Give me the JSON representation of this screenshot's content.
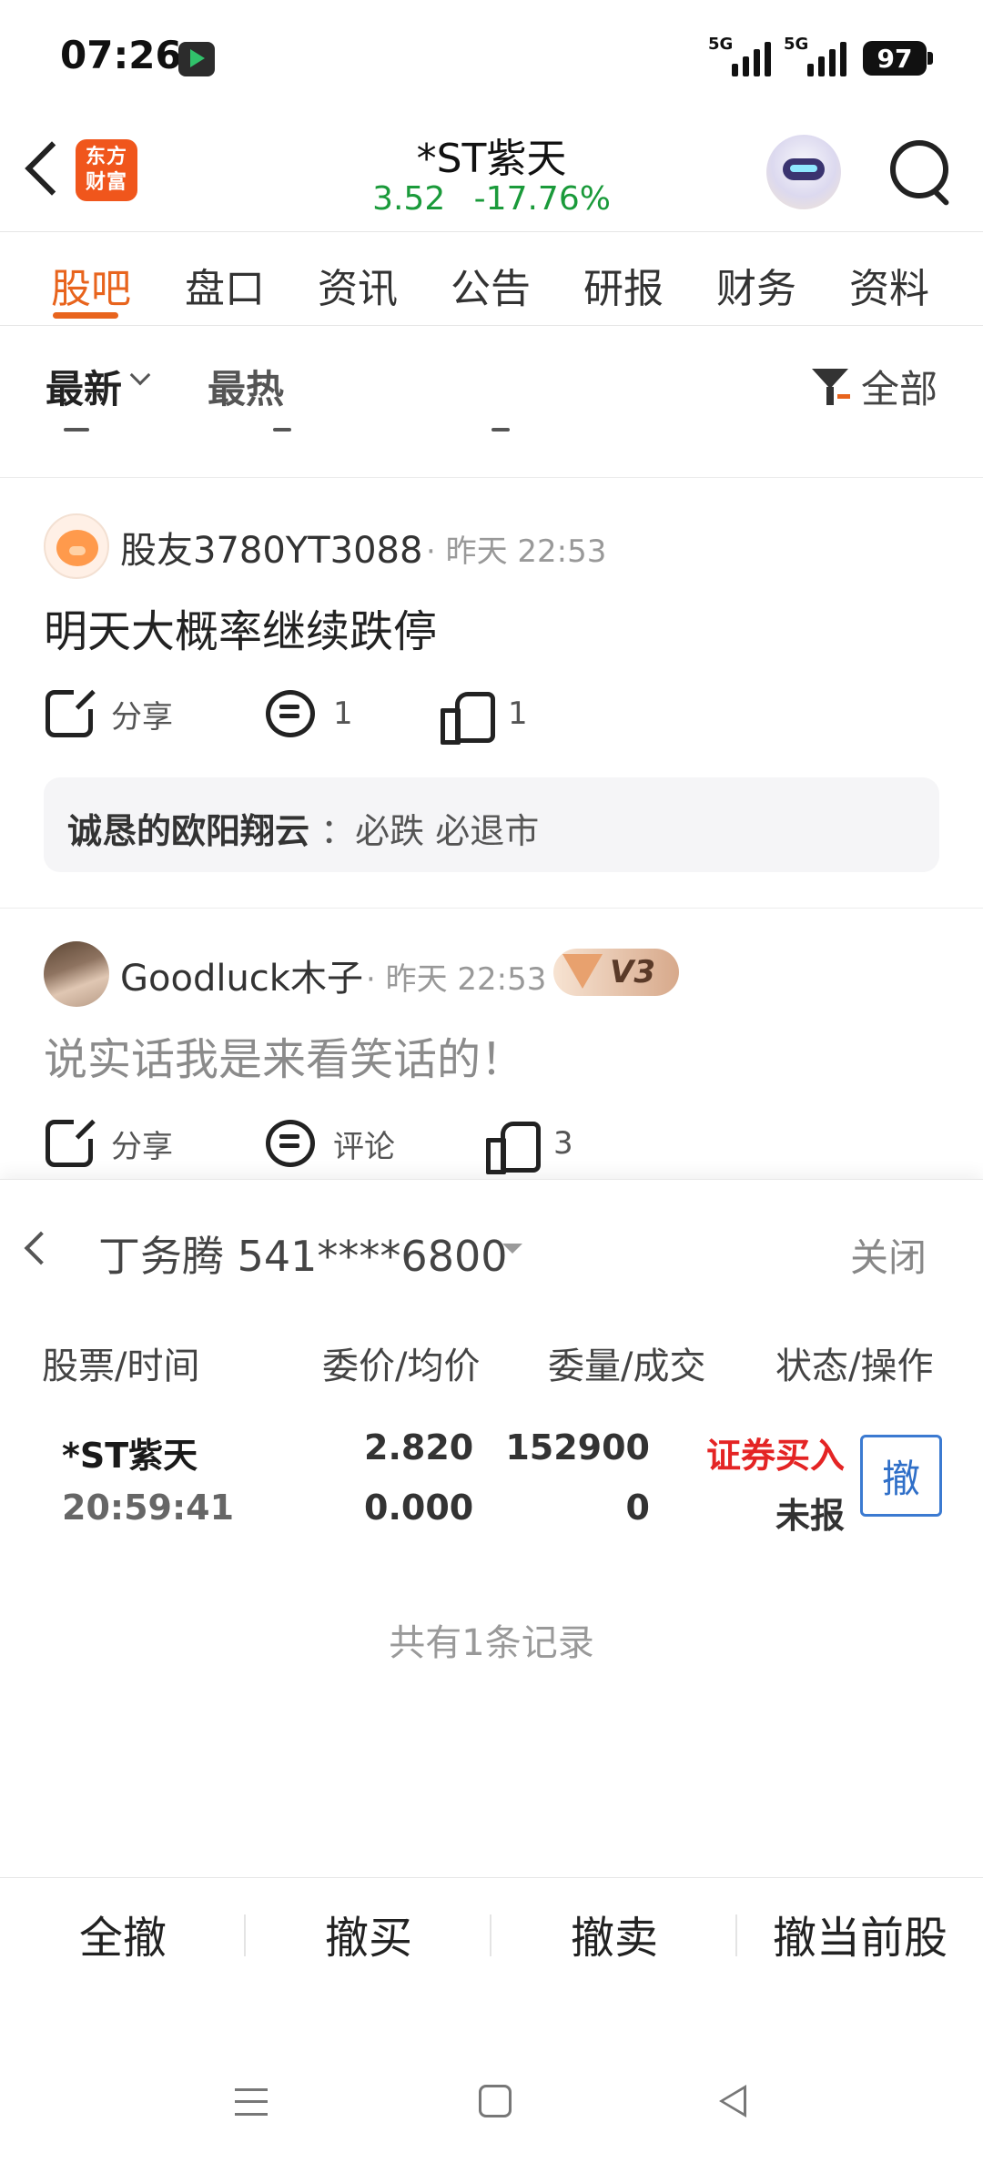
{
  "status_bar": {
    "time": "07:26",
    "signal1_label": "5G",
    "signal2_label": "5G",
    "battery": "97"
  },
  "header": {
    "logo_text": "东方财富",
    "stock_name": "*ST紫天",
    "price": "3.52",
    "change_pct": "-17.76%",
    "price_color": "#1a9a3a"
  },
  "tabs": [
    {
      "label": "股吧",
      "active": true
    },
    {
      "label": "盘口"
    },
    {
      "label": "资讯"
    },
    {
      "label": "公告"
    },
    {
      "label": "研报"
    },
    {
      "label": "财务"
    },
    {
      "label": "资料"
    }
  ],
  "sort": {
    "latest": "最新",
    "hot": "最热",
    "filter": "全部"
  },
  "posts": [
    {
      "user": "股友3780YT3088",
      "time": "· 昨天 22:53",
      "text": "明天大概率继续跌停",
      "share_label": "分享",
      "comment_count": "1",
      "like_count": "1",
      "reply": {
        "name": "诚恳的欧阳翔云",
        "text": "：必跌  必退市"
      }
    },
    {
      "user": "Goodluck木子",
      "time": "· 昨天 22:53",
      "badge": "V3",
      "text": "说实话我是来看笑话的！",
      "share_label": "分享",
      "comment_label": "评论",
      "like_count": "3"
    }
  ],
  "order_panel": {
    "account": "丁务腾 541****6800",
    "close_label": "关闭",
    "columns": [
      "股票/时间",
      "委价/均价",
      "委量/成交",
      "状态/操作"
    ],
    "order": {
      "stock": "*ST紫天",
      "time": "20:59:41",
      "order_price": "2.820",
      "avg_price": "0.000",
      "order_qty": "152900",
      "filled_qty": "0",
      "type": "证券买入",
      "status": "未报",
      "cancel_label": "撤"
    },
    "record_count": "共有1条记录",
    "actions": [
      "全撤",
      "撤买",
      "撤卖",
      "撤当前股"
    ]
  },
  "colors": {
    "accent": "#e8641d",
    "rise_fall_green": "#1a9a3a",
    "buy_red": "#e42424",
    "cancel_blue": "#2f6fc8"
  }
}
